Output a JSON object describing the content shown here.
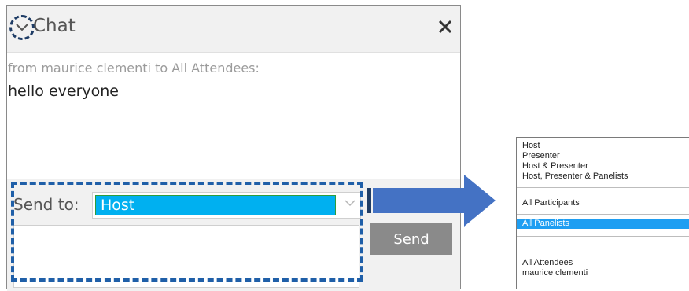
{
  "chat": {
    "title": "Chat",
    "message": {
      "meta": "from maurice clementi to All Attendees:",
      "text": "hello everyone"
    },
    "send_to_label": "Send to:",
    "selected_recipient": "Host",
    "send_button": "Send",
    "message_input_value": ""
  },
  "recipient_options": {
    "group1": [
      "Host",
      "Presenter",
      "Host & Presenter",
      "Host, Presenter & Panelists"
    ],
    "group2": [
      "All Participants"
    ],
    "group3": [
      "All Panelists"
    ],
    "group4": [
      "All Attendees",
      "maurice clementi"
    ],
    "highlighted": "All Panelists"
  },
  "colors": {
    "highlight_dashed": "#1f5fa8",
    "selection_blue": "#00b0f0",
    "option_selected": "#1e9ef2",
    "arrow": "#4472c4",
    "send_button": "#8a8a8a"
  },
  "icons": {
    "collapse": "chevron-down-icon",
    "close": "close-icon",
    "dropdown": "chevron-down-icon",
    "callout": "arrow-right-icon"
  }
}
